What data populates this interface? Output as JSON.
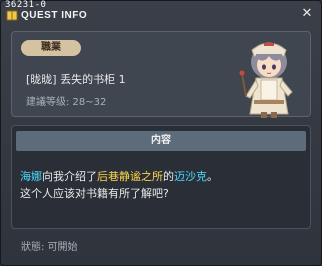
{
  "window": {
    "quest_id": "36231-0",
    "title": "QUEST INFO"
  },
  "quest": {
    "category": "職業",
    "name": "[昽昽] 丢失的书柜 1",
    "level_text": "建議等级: 28~32"
  },
  "content": {
    "header": "内容",
    "line1_npc": "海娜",
    "line1_mid1": "向我介绍了",
    "line1_place": "后巷静谧之所",
    "line1_mid2": "的",
    "line1_npc2": "迈沙克",
    "line1_end": "。",
    "line2": "这个人应该对书籍有所了解吧?"
  },
  "status": {
    "text": "狀態: 可開始"
  },
  "colors": {
    "npc_highlight": "#4dd8ff",
    "place_highlight": "#ffd54a",
    "pill": "#d4c2a0",
    "content_header": "#5d6c7a"
  },
  "icons": [
    "quest-book-icon",
    "close-icon",
    "npc-portrait"
  ]
}
